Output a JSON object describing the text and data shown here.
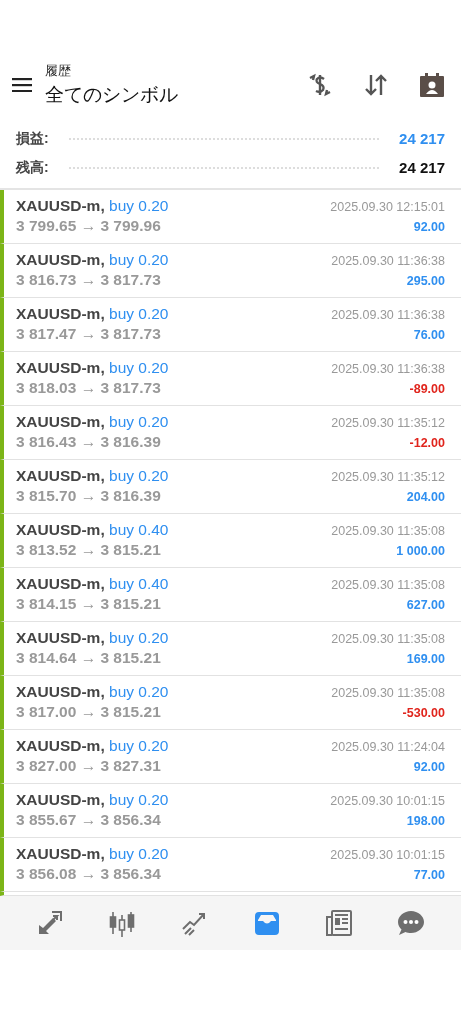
{
  "header": {
    "subtitle": "履歴",
    "title": "全てのシンボル"
  },
  "summary": [
    {
      "label": "損益:",
      "value": "24 217",
      "kind": "profit"
    },
    {
      "label": "残高:",
      "value": "24 217",
      "kind": "balance"
    }
  ],
  "deals": [
    {
      "symbol": "XAUUSD-m,",
      "side": "buy 0.20",
      "prices": "3 799.65 → 3 799.96",
      "time": "2025.09.30 12:15:01",
      "profit": "92.00",
      "loss": false
    },
    {
      "symbol": "XAUUSD-m,",
      "side": "buy 0.20",
      "prices": "3 816.73 → 3 817.73",
      "time": "2025.09.30 11:36:38",
      "profit": "295.00",
      "loss": false
    },
    {
      "symbol": "XAUUSD-m,",
      "side": "buy 0.20",
      "prices": "3 817.47 → 3 817.73",
      "time": "2025.09.30 11:36:38",
      "profit": "76.00",
      "loss": false
    },
    {
      "symbol": "XAUUSD-m,",
      "side": "buy 0.20",
      "prices": "3 818.03 → 3 817.73",
      "time": "2025.09.30 11:36:38",
      "profit": "-89.00",
      "loss": true
    },
    {
      "symbol": "XAUUSD-m,",
      "side": "buy 0.20",
      "prices": "3 816.43 → 3 816.39",
      "time": "2025.09.30 11:35:12",
      "profit": "-12.00",
      "loss": true
    },
    {
      "symbol": "XAUUSD-m,",
      "side": "buy 0.20",
      "prices": "3 815.70 → 3 816.39",
      "time": "2025.09.30 11:35:12",
      "profit": "204.00",
      "loss": false
    },
    {
      "symbol": "XAUUSD-m,",
      "side": "buy 0.40",
      "prices": "3 813.52 → 3 815.21",
      "time": "2025.09.30 11:35:08",
      "profit": "1 000.00",
      "loss": false
    },
    {
      "symbol": "XAUUSD-m,",
      "side": "buy 0.40",
      "prices": "3 814.15 → 3 815.21",
      "time": "2025.09.30 11:35:08",
      "profit": "627.00",
      "loss": false
    },
    {
      "symbol": "XAUUSD-m,",
      "side": "buy 0.20",
      "prices": "3 814.64 → 3 815.21",
      "time": "2025.09.30 11:35:08",
      "profit": "169.00",
      "loss": false
    },
    {
      "symbol": "XAUUSD-m,",
      "side": "buy 0.20",
      "prices": "3 817.00 → 3 815.21",
      "time": "2025.09.30 11:35:08",
      "profit": "-530.00",
      "loss": true
    },
    {
      "symbol": "XAUUSD-m,",
      "side": "buy 0.20",
      "prices": "3 827.00 → 3 827.31",
      "time": "2025.09.30 11:24:04",
      "profit": "92.00",
      "loss": false
    },
    {
      "symbol": "XAUUSD-m,",
      "side": "buy 0.20",
      "prices": "3 855.67 → 3 856.34",
      "time": "2025.09.30 10:01:15",
      "profit": "198.00",
      "loss": false
    },
    {
      "symbol": "XAUUSD-m,",
      "side": "buy 0.20",
      "prices": "3 856.08 → 3 856.34",
      "time": "2025.09.30 10:01:15",
      "profit": "77.00",
      "loss": false
    }
  ],
  "nav": [
    {
      "kind": "trade",
      "selected": false
    },
    {
      "kind": "chart",
      "selected": false
    },
    {
      "kind": "signals",
      "selected": false
    },
    {
      "kind": "history",
      "selected": true
    },
    {
      "kind": "news",
      "selected": false
    },
    {
      "kind": "chat",
      "selected": false
    }
  ]
}
